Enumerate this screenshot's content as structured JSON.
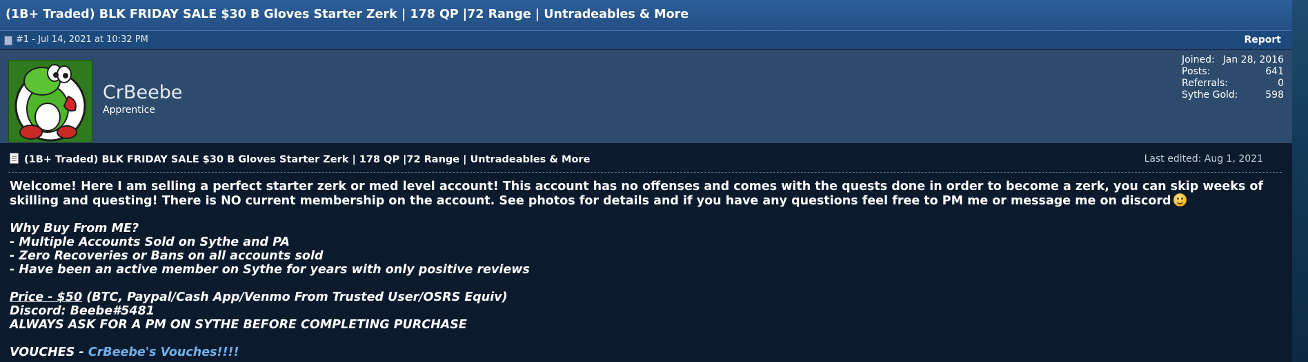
{
  "thread": {
    "title": "(1B+ Traded) BLK FRIDAY SALE $30 B Gloves Starter Zerk | 178 QP |72 Range | Untradeables & More"
  },
  "post": {
    "number_date": "#1 - Jul 14, 2021 at 10:32 PM",
    "report_label": "Report",
    "user": {
      "name": "CrBeebe",
      "title": "Apprentice",
      "stats": [
        {
          "label": "Joined:",
          "value": "Jan 28, 2016"
        },
        {
          "label": "Posts:",
          "value": "641"
        },
        {
          "label": "Referrals:",
          "value": "0"
        },
        {
          "label": "Sythe Gold:",
          "value": "598"
        }
      ]
    },
    "content_title": "(1B+ Traded) BLK FRIDAY SALE $30 B Gloves Starter Zerk | 178 QP |72 Range | Untradeables & More",
    "last_edited": "Last edited: Aug 1, 2021",
    "body": {
      "intro": "Welcome! Here I am selling a perfect starter zerk or med level account! This account has no offenses and comes with the quests done in order to become a zerk, you can skip weeks of skilling and questing! There is NO current membership on the account. See photos for details and if you have any questions feel free to PM me or message me on discord",
      "why_heading": "Why Buy From ME?",
      "why_items": [
        "- Multiple Accounts Sold on Sythe and PA",
        "- Zero Recoveries or Bans on all accounts sold",
        "- Have been an active member on Sythe for years with only positive reviews"
      ],
      "price_label": "Price - $50",
      "price_detail": " (BTC, Paypal/Cash App/Venmo From Trusted User/OSRS Equiv)",
      "discord": "Discord: Beebe#5481",
      "warning": "ALWAYS ASK FOR A PM ON SYTHE BEFORE COMPLETING PURCHASE",
      "vouches_label": "VOUCHES - ",
      "vouches_link": "CrBeebe's Vouches!!!!"
    }
  }
}
